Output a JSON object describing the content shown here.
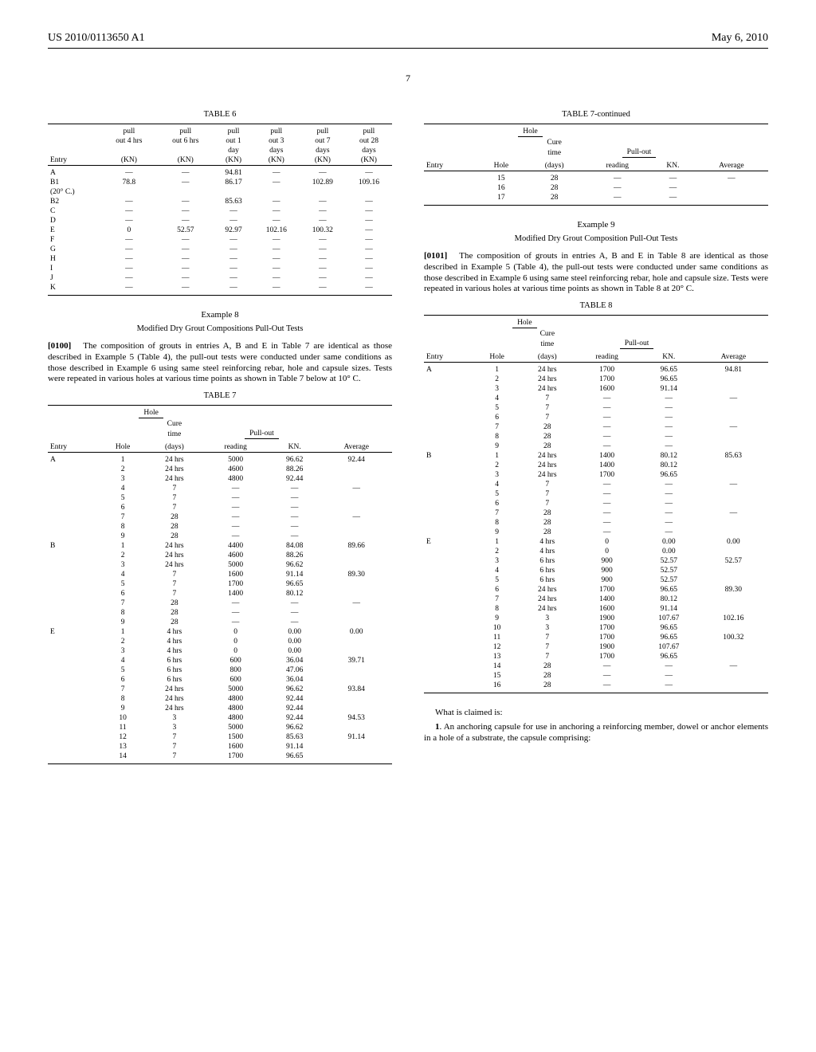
{
  "header": {
    "pub_no": "US 2010/0113650 A1",
    "date": "May 6, 2010",
    "page": "7"
  },
  "table6": {
    "title": "TABLE 6",
    "headers": [
      "Entry",
      "pull out 4 hrs (KN)",
      "pull out 6 hrs (KN)",
      "pull out 1 day (KN)",
      "pull out 3 days (KN)",
      "pull out 7 days (KN)",
      "pull out 28 days (KN)"
    ],
    "rows": [
      [
        "A",
        "—",
        "—",
        "94.81",
        "—",
        "—",
        "—"
      ],
      [
        "B1 (20° C.)",
        "78.8",
        "—",
        "86.17",
        "—",
        "102.89",
        "109.16"
      ],
      [
        "B2",
        "—",
        "—",
        "85.63",
        "—",
        "—",
        "—"
      ],
      [
        "C",
        "—",
        "—",
        "—",
        "—",
        "—",
        "—"
      ],
      [
        "D",
        "—",
        "—",
        "—",
        "—",
        "—",
        "—"
      ],
      [
        "E",
        "0",
        "52.57",
        "92.97",
        "102.16",
        "100.32",
        "—"
      ],
      [
        "F",
        "—",
        "—",
        "—",
        "—",
        "—",
        "—"
      ],
      [
        "G",
        "—",
        "—",
        "—",
        "—",
        "—",
        "—"
      ],
      [
        "H",
        "—",
        "—",
        "—",
        "—",
        "—",
        "—"
      ],
      [
        "I",
        "—",
        "—",
        "—",
        "—",
        "—",
        "—"
      ],
      [
        "J",
        "—",
        "—",
        "—",
        "—",
        "—",
        "—"
      ],
      [
        "K",
        "—",
        "—",
        "—",
        "—",
        "—",
        "—"
      ]
    ]
  },
  "example8": {
    "title": "Example 8",
    "subtitle": "Modified Dry Grout Compositions Pull-Out Tests",
    "para_num": "[0100]",
    "para": "The composition of grouts in entries A, B and E in Table 7 are identical as those described in Example 5 (Table 4), the pull-out tests were conducted under same conditions as those described in Example 6 using same steel reinforcing rebar, hole and capsule sizes. Tests were repeated in various holes at various time points as shown in Table 7 below at 10° C."
  },
  "table7": {
    "title": "TABLE 7",
    "group_heads": {
      "hole": "Hole",
      "pullout": "Pull-out"
    },
    "headers": [
      "Entry",
      "Hole",
      "Cure time (days)",
      "reading",
      "KN.",
      "Average"
    ],
    "rows": [
      [
        "A",
        "1",
        "24 hrs",
        "5000",
        "96.62",
        "92.44"
      ],
      [
        "",
        "2",
        "24 hrs",
        "4600",
        "88.26",
        ""
      ],
      [
        "",
        "3",
        "24 hrs",
        "4800",
        "92.44",
        ""
      ],
      [
        "",
        "4",
        "7",
        "—",
        "—",
        "—"
      ],
      [
        "",
        "5",
        "7",
        "—",
        "—",
        ""
      ],
      [
        "",
        "6",
        "7",
        "—",
        "—",
        ""
      ],
      [
        "",
        "7",
        "28",
        "—",
        "—",
        "—"
      ],
      [
        "",
        "8",
        "28",
        "—",
        "—",
        ""
      ],
      [
        "",
        "9",
        "28",
        "—",
        "—",
        ""
      ],
      [
        "B",
        "1",
        "24 hrs",
        "4400",
        "84.08",
        "89.66"
      ],
      [
        "",
        "2",
        "24 hrs",
        "4600",
        "88.26",
        ""
      ],
      [
        "",
        "3",
        "24 hrs",
        "5000",
        "96.62",
        ""
      ],
      [
        "",
        "4",
        "7",
        "1600",
        "91.14",
        "89.30"
      ],
      [
        "",
        "5",
        "7",
        "1700",
        "96.65",
        ""
      ],
      [
        "",
        "6",
        "7",
        "1400",
        "80.12",
        ""
      ],
      [
        "",
        "7",
        "28",
        "—",
        "—",
        "—"
      ],
      [
        "",
        "8",
        "28",
        "—",
        "—",
        ""
      ],
      [
        "",
        "9",
        "28",
        "—",
        "—",
        ""
      ],
      [
        "E",
        "1",
        "4 hrs",
        "0",
        "0.00",
        "0.00"
      ],
      [
        "",
        "2",
        "4 hrs",
        "0",
        "0.00",
        ""
      ],
      [
        "",
        "3",
        "4 hrs",
        "0",
        "0.00",
        ""
      ],
      [
        "",
        "4",
        "6 hrs",
        "600",
        "36.04",
        "39.71"
      ],
      [
        "",
        "5",
        "6 hrs",
        "800",
        "47.06",
        ""
      ],
      [
        "",
        "6",
        "6 hrs",
        "600",
        "36.04",
        ""
      ],
      [
        "",
        "7",
        "24 hrs",
        "5000",
        "96.62",
        "93.84"
      ],
      [
        "",
        "8",
        "24 hrs",
        "4800",
        "92.44",
        ""
      ],
      [
        "",
        "9",
        "24 hrs",
        "4800",
        "92.44",
        ""
      ],
      [
        "",
        "10",
        "3",
        "4800",
        "92.44",
        "94.53"
      ],
      [
        "",
        "11",
        "3",
        "5000",
        "96.62",
        ""
      ],
      [
        "",
        "12",
        "7",
        "1500",
        "85.63",
        "91.14"
      ],
      [
        "",
        "13",
        "7",
        "1600",
        "91.14",
        ""
      ],
      [
        "",
        "14",
        "7",
        "1700",
        "96.65",
        ""
      ]
    ]
  },
  "table7c": {
    "title": "TABLE 7-continued",
    "group_heads": {
      "hole": "Hole",
      "pullout": "Pull-out"
    },
    "headers": [
      "Entry",
      "Hole",
      "Cure time (days)",
      "reading",
      "KN.",
      "Average"
    ],
    "rows": [
      [
        "",
        "15",
        "28",
        "—",
        "—",
        "—"
      ],
      [
        "",
        "16",
        "28",
        "—",
        "—",
        ""
      ],
      [
        "",
        "17",
        "28",
        "—",
        "—",
        ""
      ]
    ]
  },
  "example9": {
    "title": "Example 9",
    "subtitle": "Modified Dry Grout Composition Pull-Out Tests",
    "para_num": "[0101]",
    "para": "The composition of grouts in entries A, B and E in Table 8 are identical as those described in Example 5 (Table 4), the pull-out tests were conducted under same conditions as those described in Example 6 using same steel reinforcing rebar, hole and capsule size. Tests were repeated in various holes at various time points as shown in Table 8 at 20° C."
  },
  "table8": {
    "title": "TABLE 8",
    "group_heads": {
      "hole": "Hole",
      "pullout": "Pull-out"
    },
    "headers": [
      "Entry",
      "Hole",
      "Cure time (days)",
      "reading",
      "KN.",
      "Average"
    ],
    "rows": [
      [
        "A",
        "1",
        "24 hrs",
        "1700",
        "96.65",
        "94.81"
      ],
      [
        "",
        "2",
        "24 hrs",
        "1700",
        "96.65",
        ""
      ],
      [
        "",
        "3",
        "24 hrs",
        "1600",
        "91.14",
        ""
      ],
      [
        "",
        "4",
        "7",
        "—",
        "—",
        "—"
      ],
      [
        "",
        "5",
        "7",
        "—",
        "—",
        ""
      ],
      [
        "",
        "6",
        "7",
        "—",
        "—",
        ""
      ],
      [
        "",
        "7",
        "28",
        "—",
        "—",
        "—"
      ],
      [
        "",
        "8",
        "28",
        "—",
        "—",
        ""
      ],
      [
        "",
        "9",
        "28",
        "—",
        "—",
        ""
      ],
      [
        "B",
        "1",
        "24 hrs",
        "1400",
        "80.12",
        "85.63"
      ],
      [
        "",
        "2",
        "24 hrs",
        "1400",
        "80.12",
        ""
      ],
      [
        "",
        "3",
        "24 hrs",
        "1700",
        "96.65",
        ""
      ],
      [
        "",
        "4",
        "7",
        "—",
        "—",
        "—"
      ],
      [
        "",
        "5",
        "7",
        "—",
        "—",
        ""
      ],
      [
        "",
        "6",
        "7",
        "—",
        "—",
        ""
      ],
      [
        "",
        "7",
        "28",
        "—",
        "—",
        "—"
      ],
      [
        "",
        "8",
        "28",
        "—",
        "—",
        ""
      ],
      [
        "",
        "9",
        "28",
        "—",
        "—",
        ""
      ],
      [
        "E",
        "1",
        "4 hrs",
        "0",
        "0.00",
        "0.00"
      ],
      [
        "",
        "2",
        "4 hrs",
        "0",
        "0.00",
        ""
      ],
      [
        "",
        "3",
        "6 hrs",
        "900",
        "52.57",
        "52.57"
      ],
      [
        "",
        "4",
        "6 hrs",
        "900",
        "52.57",
        ""
      ],
      [
        "",
        "5",
        "6 hrs",
        "900",
        "52.57",
        ""
      ],
      [
        "",
        "6",
        "24 hrs",
        "1700",
        "96.65",
        "89.30"
      ],
      [
        "",
        "7",
        "24 hrs",
        "1400",
        "80.12",
        ""
      ],
      [
        "",
        "8",
        "24 hrs",
        "1600",
        "91.14",
        ""
      ],
      [
        "",
        "9",
        "3",
        "1900",
        "107.67",
        "102.16"
      ],
      [
        "",
        "10",
        "3",
        "1700",
        "96.65",
        ""
      ],
      [
        "",
        "11",
        "7",
        "1700",
        "96.65",
        "100.32"
      ],
      [
        "",
        "12",
        "7",
        "1900",
        "107.67",
        ""
      ],
      [
        "",
        "13",
        "7",
        "1700",
        "96.65",
        ""
      ],
      [
        "",
        "14",
        "28",
        "—",
        "—",
        "—"
      ],
      [
        "",
        "15",
        "28",
        "—",
        "—",
        ""
      ],
      [
        "",
        "16",
        "28",
        "—",
        "—",
        ""
      ]
    ]
  },
  "claims": {
    "intro": "What is claimed is:",
    "claim1": "1. An anchoring capsule for use in anchoring a reinforcing member, dowel or anchor elements in a hole of a substrate, the capsule comprising:"
  },
  "chart_data": [
    {
      "type": "table",
      "title": "TABLE 6 — Pull-out (KN) vs cure time",
      "columns": [
        "Entry",
        "4 hrs",
        "6 hrs",
        "1 day",
        "3 days",
        "7 days",
        "28 days"
      ],
      "rows": [
        [
          "A",
          null,
          null,
          94.81,
          null,
          null,
          null
        ],
        [
          "B1 (20° C.)",
          78.8,
          null,
          86.17,
          null,
          102.89,
          109.16
        ],
        [
          "B2",
          null,
          null,
          85.63,
          null,
          null,
          null
        ],
        [
          "E",
          0,
          52.57,
          92.97,
          102.16,
          100.32,
          null
        ]
      ]
    },
    {
      "type": "table",
      "title": "TABLE 7 — Pull-out tests at 10° C.",
      "columns": [
        "Entry",
        "Hole",
        "Cure time",
        "reading",
        "KN",
        "Average"
      ],
      "rows": "see table7.rows + table7c.rows"
    },
    {
      "type": "table",
      "title": "TABLE 8 — Pull-out tests at 20° C.",
      "columns": [
        "Entry",
        "Hole",
        "Cure time",
        "reading",
        "KN",
        "Average"
      ],
      "rows": "see table8.rows"
    }
  ]
}
